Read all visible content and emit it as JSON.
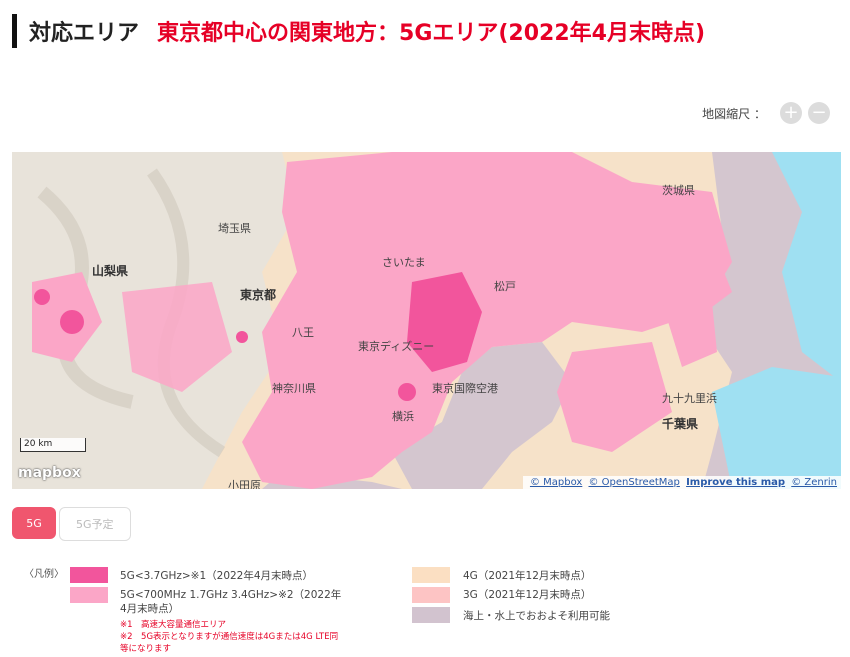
{
  "header": {
    "title": "対応エリア",
    "subtitle": "東京都中心の関東地方：5Gエリア(2022年4月末時点)"
  },
  "zoom": {
    "label": "地図縮尺 ：",
    "plus": "+",
    "minus": "−"
  },
  "map": {
    "labels": {
      "yamanashi": "山梨県",
      "tokyo": "東京都",
      "saitama_pref": "埼玉県",
      "ibaraki": "茨城県",
      "saitama": "さいたま",
      "tokyo_dt": "東京ディズニー",
      "kanagawa": "神奈川県",
      "chiba": "千葉県",
      "kujukuri": "九十九里浜",
      "yokohama": "横浜",
      "matsudo": "松戸",
      "airport": "東京国際空港",
      "odawara": "小田原",
      "hachioji": "八王"
    },
    "scale_label": "20 km",
    "logo": "mapbox",
    "attribution": [
      "© Mapbox",
      "© OpenStreetMap",
      "Improve this map",
      "© Zenrin"
    ]
  },
  "tabs": [
    {
      "label": "5G"
    },
    {
      "label": "5G予定"
    }
  ],
  "legend": {
    "head": "〈凡例〉",
    "items": {
      "g5_37": {
        "text": "5G<3.7GHz>※1（2022年4月末時点）",
        "color": "#f2559c"
      },
      "g5_sub6": {
        "line1": "5G<700MHz 1.7GHz 3.4GHz>※2（2022年",
        "line2": "4月末時点）",
        "color": "#fba6c7"
      },
      "g4": {
        "text": "4G（2021年12月末時点）",
        "color": "#fbdfc2"
      },
      "g3": {
        "text": "3G（2021年12月末時点）",
        "color": "#fdc4c4"
      },
      "sea": {
        "text": "海上・水上でおおよそ利用可能",
        "color": "#d2c3cf"
      }
    },
    "notes": {
      "n1": "※1　高速大容量通信エリア",
      "n2a": "※2　5G表示となりますが通信速度は4Gまたは4G LTE同",
      "n2b": "等になります"
    }
  }
}
